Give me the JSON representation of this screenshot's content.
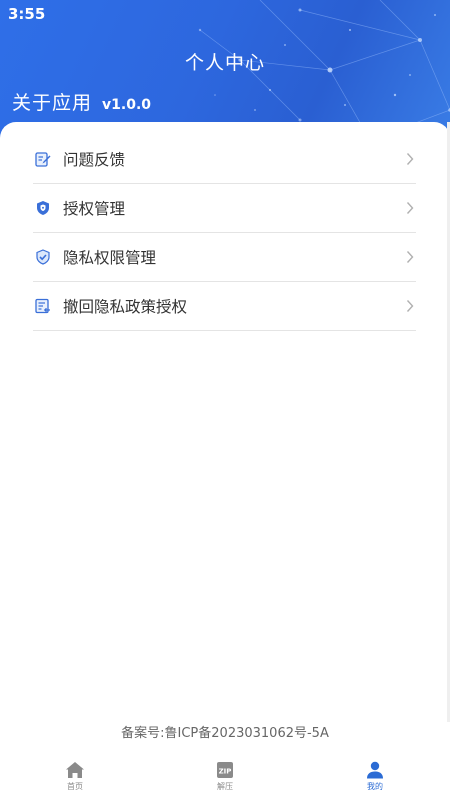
{
  "status_bar": {
    "time": "3:55"
  },
  "header": {
    "title": "个人中心",
    "about_label": "关于应用",
    "version": "v1.0.0",
    "colors": {
      "gradient_start": "#2f6fe8",
      "gradient_end": "#3a7de6"
    }
  },
  "menu": {
    "items": [
      {
        "label": "问题反馈",
        "icon": "feedback-edit-icon"
      },
      {
        "label": "授权管理",
        "icon": "shield-icon"
      },
      {
        "label": "隐私权限管理",
        "icon": "shield-check-icon"
      },
      {
        "label": "撤回隐私政策授权",
        "icon": "document-revoke-icon"
      }
    ],
    "chevron_icon": "chevron-right-icon"
  },
  "footer": {
    "icp": "备案号:鲁ICP备2023031062号-5A"
  },
  "tabbar": {
    "tabs": [
      {
        "label": "首页",
        "icon": "home-icon",
        "active": false
      },
      {
        "label": "解压",
        "icon": "zip-icon",
        "active": false
      },
      {
        "label": "我的",
        "icon": "person-icon",
        "active": true
      }
    ],
    "colors": {
      "active": "#2b6bd4",
      "inactive": "#8a8a8a"
    }
  }
}
